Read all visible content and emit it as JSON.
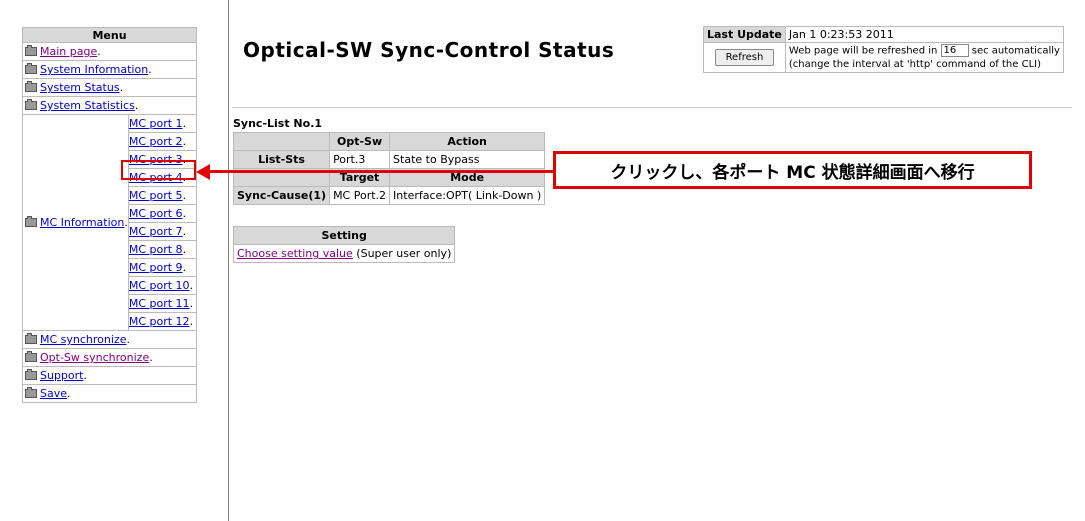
{
  "menu": {
    "heading": "Menu",
    "items_top": [
      {
        "label": "Main page",
        "visited": true
      },
      {
        "label": "System Information",
        "visited": false
      },
      {
        "label": "System Status",
        "visited": false
      },
      {
        "label": "System Statistics",
        "visited": false
      }
    ],
    "mc_info_label": "MC Information",
    "mc_ports": [
      "MC port 1",
      "MC port 2",
      "MC port 3",
      "MC port 4",
      "MC port 5",
      "MC port 6",
      "MC port 7",
      "MC port 8",
      "MC port 9",
      "MC port 10",
      "MC port 11",
      "MC port 12"
    ],
    "items_bottom": [
      {
        "label": "MC synchronize",
        "visited": false
      },
      {
        "label": "Opt-Sw synchronize",
        "visited": true
      },
      {
        "label": "Support",
        "visited": false
      },
      {
        "label": "Save",
        "visited": false
      }
    ]
  },
  "header": {
    "title": "Optical-SW Sync-Control Status"
  },
  "update": {
    "last_update_label": "Last Update",
    "last_update_value": "Jan 1 0:23:53 2011",
    "refresh_label": "Refresh",
    "refresh_text_pre": "Web page will be refreshed in",
    "interval_value": "16",
    "refresh_text_post": "sec automatically",
    "refresh_note": "(change the interval at 'http' command of the CLI)"
  },
  "sync": {
    "list_title": "Sync-List No.1",
    "col_optsw": "Opt-Sw",
    "col_action": "Action",
    "row1_label": "List-Sts",
    "row1_optsw": "Port.3",
    "row1_action": "State to Bypass",
    "col_target": "Target",
    "col_mode": "Mode",
    "row2_label": "Sync-Cause(1)",
    "row2_target": "MC Port.2",
    "row2_mode": "Interface:OPT( Link-Down )"
  },
  "setting": {
    "heading": "Setting",
    "link_label": "Choose setting value",
    "note": "(Super user only)"
  },
  "annotation": {
    "callout_text": "クリックし、各ポート MC 状態詳細画面へ移行",
    "color": "#e00000"
  }
}
